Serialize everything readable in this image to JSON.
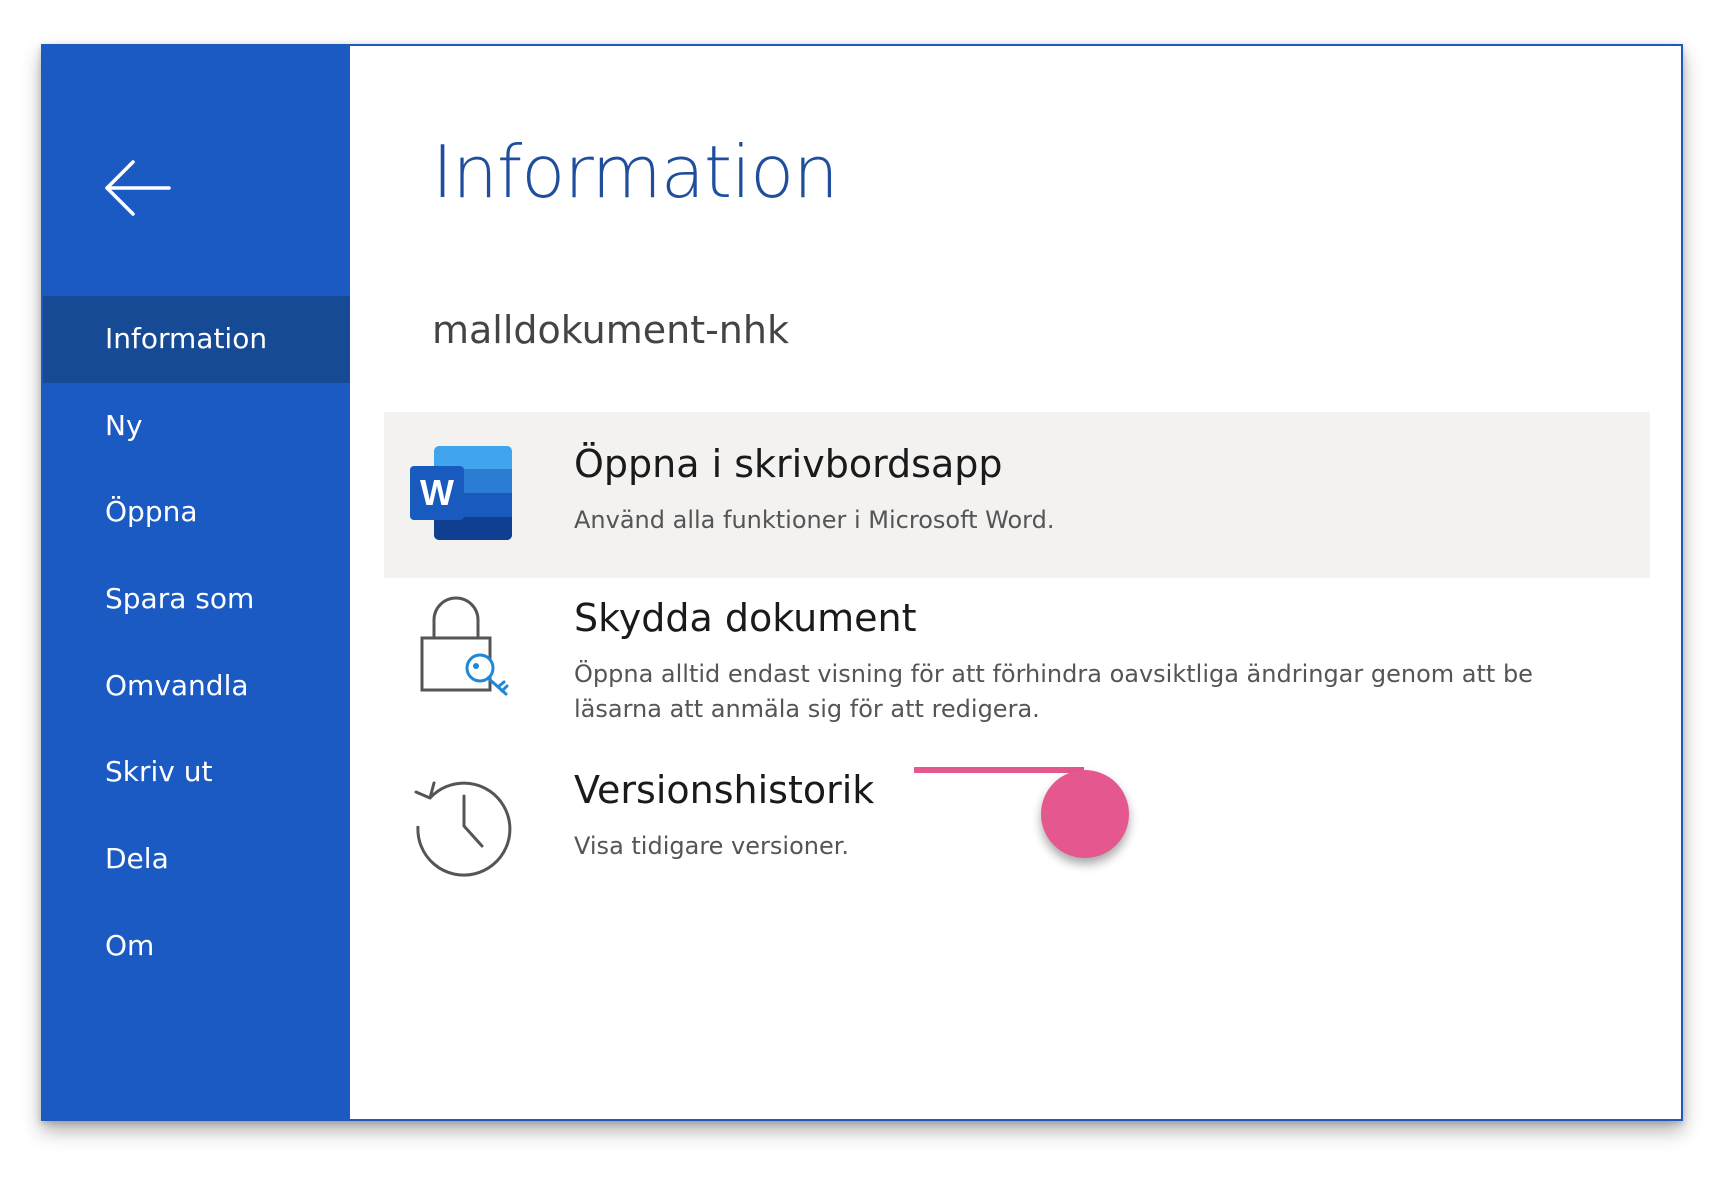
{
  "sidebar": {
    "back_icon": "arrow-left-icon",
    "items": [
      {
        "label": "Information",
        "active": true
      },
      {
        "label": "Ny"
      },
      {
        "label": "Öppna"
      },
      {
        "label": "Spara som"
      },
      {
        "label": "Omvandla"
      },
      {
        "label": "Skriv ut"
      },
      {
        "label": "Dela"
      },
      {
        "label": "Om"
      }
    ]
  },
  "main": {
    "title": "Information",
    "document_name": "malldokument-nhk",
    "actions": [
      {
        "title": "Öppna i skrivbordsapp",
        "description": "Använd alla funktioner i Microsoft Word.",
        "icon": "word-app-icon"
      },
      {
        "title": "Skydda dokument",
        "description": "Öppna alltid endast visning för att förhindra oavsiktliga ändringar genom att be läsarna att anmäla sig för att redigera.",
        "icon": "lock-key-icon"
      },
      {
        "title": "Versionshistorik",
        "description": "Visa tidigare versioner.",
        "icon": "history-clock-icon"
      }
    ]
  },
  "colors": {
    "sidebar": "#1b5ac2",
    "sidebar_active": "#174a94",
    "title": "#1e4e9c",
    "highlight": "#f3f2f1",
    "pointer": "#e5578f"
  }
}
